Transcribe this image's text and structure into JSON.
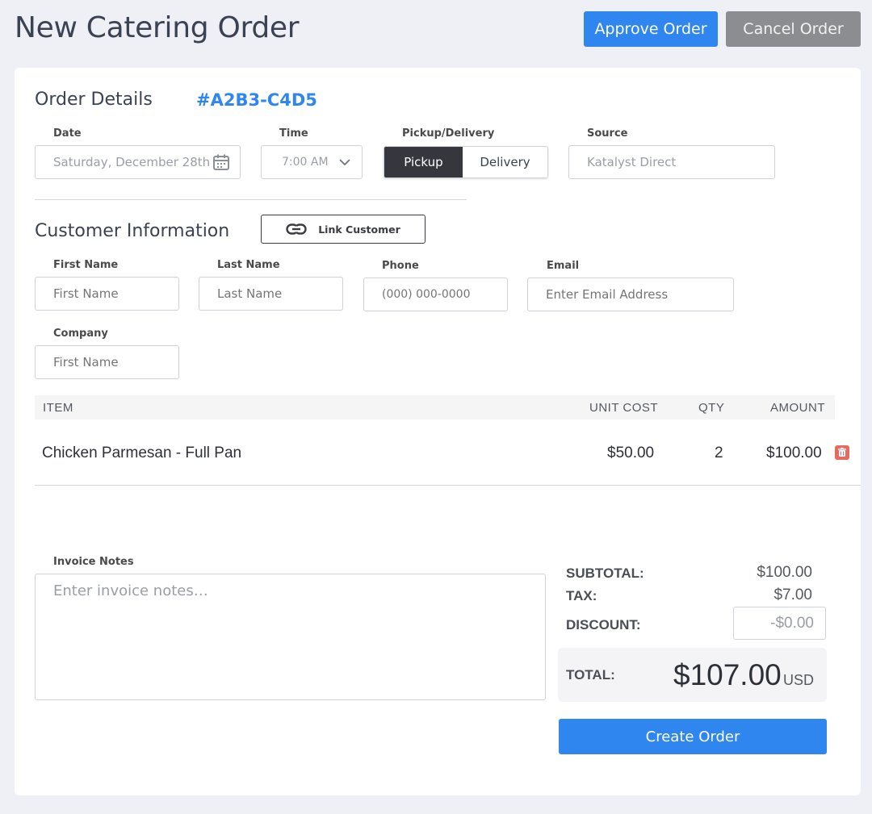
{
  "page": {
    "title": "New Catering Order"
  },
  "header_actions": {
    "approve_label": "Approve Order",
    "cancel_label": "Cancel Order"
  },
  "colors": {
    "accent": "#2f86ee",
    "cancel": "#8c8d90",
    "dark_toggle": "#35373c",
    "delete": "#e8695f"
  },
  "order_details": {
    "title": "Order Details",
    "order_id": "#A2B3-C4D5",
    "date": {
      "label": "Date",
      "value": "Saturday, December 28th",
      "icon": "calendar-icon"
    },
    "time": {
      "label": "Time",
      "value": "7:00 AM",
      "icon": "chevron-down-icon"
    },
    "pickup_delivery": {
      "label": "Pickup/Delivery",
      "options": [
        "Pickup",
        "Delivery"
      ],
      "selected": "Pickup"
    },
    "source": {
      "label": "Source",
      "value": "Katalyst Direct"
    }
  },
  "customer": {
    "title": "Customer Information",
    "link_label": "Link Customer",
    "link_icon": "link-icon",
    "first_name": {
      "label": "First Name",
      "placeholder": "First Name"
    },
    "last_name": {
      "label": "Last Name",
      "placeholder": "Last Name"
    },
    "phone": {
      "label": "Phone",
      "placeholder": "(000) 000-0000"
    },
    "email": {
      "label": "Email",
      "placeholder": "Enter Email Address"
    },
    "company": {
      "label": "Company",
      "placeholder": "First Name"
    }
  },
  "items_table": {
    "columns": [
      "ITEM",
      "UNIT COST",
      "QTY",
      "AMOUNT"
    ],
    "rows": [
      {
        "item": "Chicken Parmesan - Full Pan",
        "unit_cost": "$50.00",
        "qty": "2",
        "amount": "$100.00",
        "delete_icon": "trash-icon"
      }
    ]
  },
  "invoice_notes": {
    "label": "Invoice Notes",
    "placeholder": "Enter invoice notes…"
  },
  "summary": {
    "subtotal_label": "SUBTOTAL:",
    "subtotal": "$100.00",
    "tax_label": "TAX:",
    "tax": "$7.00",
    "discount_label": "DISCOUNT:",
    "discount_placeholder": "-$0.00",
    "total_label": "TOTAL:",
    "total": "$107.00",
    "currency": "USD"
  },
  "create_label": "Create Order"
}
